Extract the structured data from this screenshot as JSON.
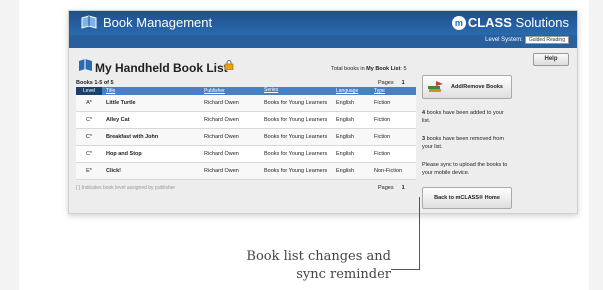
{
  "app": {
    "title": "Book Management",
    "brand_circle": "m",
    "brand_bold": "CLASS",
    "brand_rest": " Solutions"
  },
  "level_system": {
    "label": "Level System:",
    "value": "Guided Reading"
  },
  "help_label": "Help",
  "page": {
    "title": "My Handheld Book List",
    "total_label": "Total books in",
    "total_list_name": "My Book List",
    "total_count": "5"
  },
  "pagination": {
    "range": "Books 1-5 of 5",
    "pages_label": "Pages",
    "page_number": "1"
  },
  "table": {
    "headers": [
      "Level",
      "Title",
      "Publisher",
      "Series",
      "Language",
      "Type"
    ],
    "rows": [
      {
        "level": "A*",
        "title": "Little Turtle",
        "publisher": "Richard Owen",
        "series": "Books for Young Learners",
        "language": "English",
        "type": "Fiction"
      },
      {
        "level": "C*",
        "title": "Alley Cat",
        "publisher": "Richard Owen",
        "series": "Books for Young Learners",
        "language": "English",
        "type": "Fiction"
      },
      {
        "level": "C*",
        "title": "Breakfast with John",
        "publisher": "Richard Owen",
        "series": "Books for Young Learners",
        "language": "English",
        "type": "Fiction"
      },
      {
        "level": "C*",
        "title": "Hop and Stop",
        "publisher": "Richard Owen",
        "series": "Books for Young Learners",
        "language": "English",
        "type": "Fiction"
      },
      {
        "level": "E*",
        "title": "Click!",
        "publisher": "Richard Owen",
        "series": "Books for Young Learners",
        "language": "English",
        "type": "Non-Fiction"
      }
    ]
  },
  "footnote": "[ ] Indicates book level assigned by publisher",
  "panel": {
    "add_remove_label": "Add/Remove Books",
    "added_count": "4",
    "added_text": "books have been added to your list.",
    "removed_count": "3",
    "removed_text": "books have been removed from your list.",
    "sync_text": "Please sync to upload the books to your mobile device.",
    "home_label": "Back to mCLASS® Home"
  },
  "caption": {
    "line1": "Book list changes and",
    "line2": "sync reminder"
  },
  "colors": {
    "header_blue": "#2a6ab0",
    "table_header": "#4a7fc1"
  }
}
